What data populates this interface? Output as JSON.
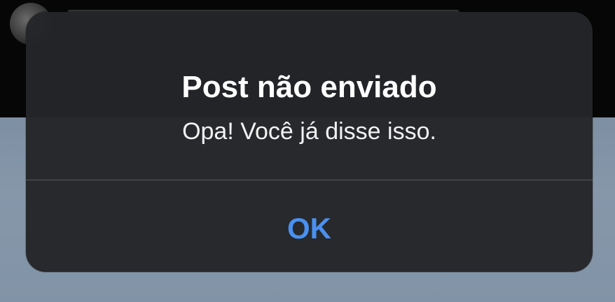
{
  "alert": {
    "title": "Post não enviado",
    "message": "Opa! Você já disse isso.",
    "ok_label": "OK"
  },
  "colors": {
    "alert_background": "#242528",
    "title_text": "#ffffff",
    "button_text": "#4a90f0",
    "divider": "#595b60",
    "backdrop_top": "#060606",
    "backdrop_content": "#8193a6"
  }
}
